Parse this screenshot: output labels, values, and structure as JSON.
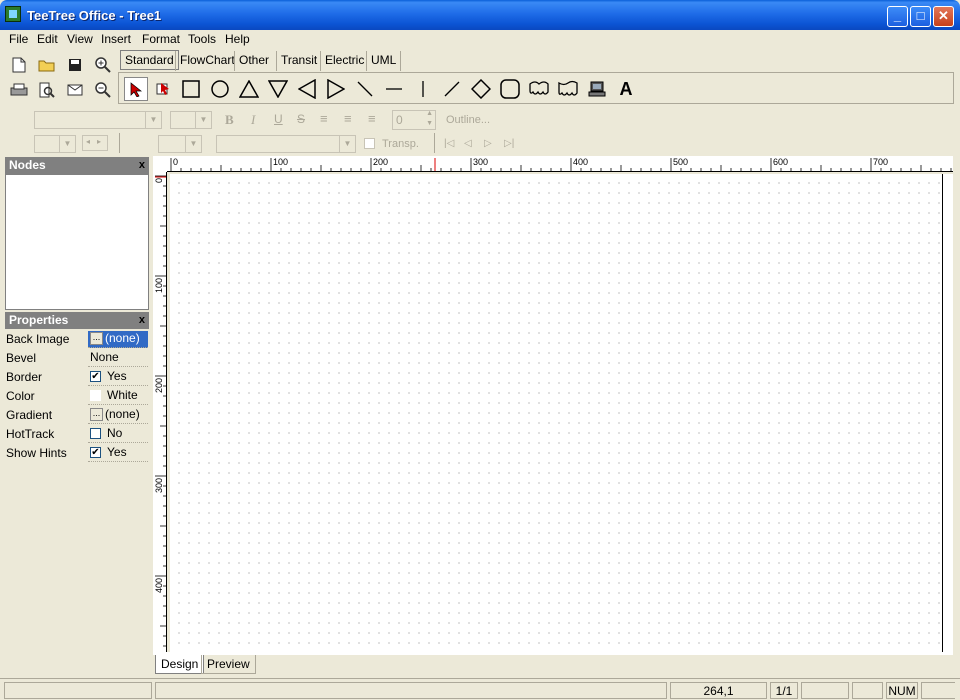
{
  "window": {
    "title": "TeeTree Office - Tree1"
  },
  "menu": [
    "File",
    "Edit",
    "View",
    "Insert",
    "Format",
    "Tools",
    "Help"
  ],
  "tabs": [
    "Standard",
    "FlowChart",
    "Other",
    "Transit",
    "Electric",
    "UML"
  ],
  "format_bar": {
    "size_value": "0",
    "outline_label": "Outline...",
    "transp_label": "Transp."
  },
  "nodes_panel": {
    "title": "Nodes",
    "close": "x"
  },
  "properties_panel": {
    "title": "Properties",
    "close": "x",
    "rows": [
      {
        "name": "Back Image",
        "value": "(none)"
      },
      {
        "name": "Bevel",
        "value": "None"
      },
      {
        "name": "Border",
        "value": "Yes"
      },
      {
        "name": "Color",
        "value": "White"
      },
      {
        "name": "Gradient",
        "value": "(none)"
      },
      {
        "name": "HotTrack",
        "value": "No"
      },
      {
        "name": "Show Hints",
        "value": "Yes"
      }
    ]
  },
  "ruler": {
    "h": [
      "0",
      "100",
      "200",
      "300",
      "400",
      "500",
      "600",
      "700"
    ],
    "v": [
      "0",
      "100",
      "200",
      "300",
      "400"
    ]
  },
  "bottom_tabs": [
    "Design",
    "Preview"
  ],
  "status": {
    "coords": "264,1",
    "page": "1/1",
    "num": "NUM"
  }
}
